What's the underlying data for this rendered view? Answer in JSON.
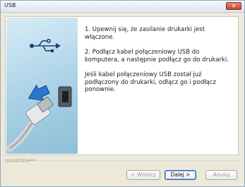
{
  "window": {
    "title": "USB"
  },
  "icons": {
    "close": "close-icon",
    "usb": "usb-symbol-icon",
    "arrow": "arrow-icon",
    "connector": "usb-connector-icon"
  },
  "instructions": [
    "1. Upewnij się, że zasilanie drukarki jest włączone.",
    "2. Podłącz kabel połączeniowy USB do komputera, a następnie podłącz go do drukarki.",
    "Jeśli kabel połączeniowy USB został już podłączony do drukarki, odłącz go i podłącz ponownie."
  ],
  "footer": {
    "installshield": "InstallShield"
  },
  "buttons": {
    "back": "< Wstecz",
    "next": "Dalej >",
    "cancel": "Anuluj"
  },
  "colors": {
    "accent": "#245dc5",
    "close": "#c4442b",
    "art_bg": "#a9d1e6"
  }
}
